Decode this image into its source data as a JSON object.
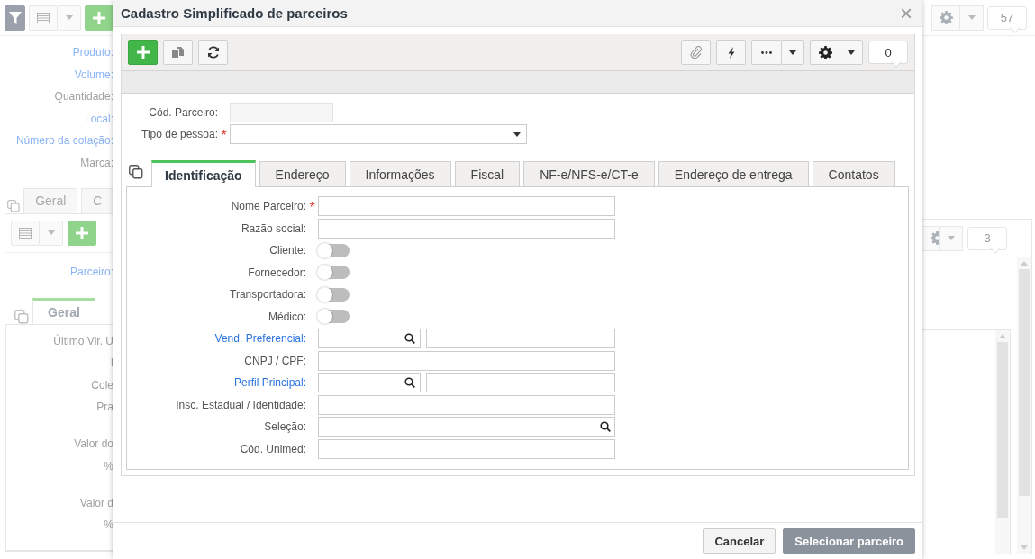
{
  "background": {
    "top_badge": "57",
    "fields": [
      {
        "label": "Produto:",
        "link": true
      },
      {
        "label": "Volume:",
        "link": true
      },
      {
        "label": "Quantidade:",
        "link": false
      },
      {
        "label": "Local:",
        "link": true
      },
      {
        "label": "Número da cotação:",
        "link": true
      },
      {
        "label": "Marca:",
        "link": false
      }
    ],
    "tabs": [
      {
        "label": "Geral",
        "selected": false
      },
      {
        "label": "C",
        "selected": false
      }
    ],
    "panel": {
      "badge": "3",
      "fields": [
        {
          "label": "Parceiro:",
          "link": true
        }
      ],
      "tabs": [
        {
          "label": "Geral",
          "selected": true
        }
      ],
      "label_groups": [
        [
          "Último Vlr. U",
          "I",
          "Cole",
          "Pra"
        ],
        [
          "Valor do",
          "%"
        ],
        [
          "Valor d",
          "%"
        ]
      ]
    }
  },
  "dialog": {
    "title": "Cadastro Simplificado de parceiros",
    "close": "×",
    "required_mark": "*",
    "badge": "0",
    "cod_parceiro": {
      "label": "Cód. Parceiro:",
      "disabled": true
    },
    "tipo_pessoa": {
      "label": "Tipo de pessoa:",
      "required": true
    },
    "tabs": [
      {
        "label": "Identificação",
        "selected": true
      },
      {
        "label": "Endereço",
        "selected": false
      },
      {
        "label": "Informações",
        "selected": false
      },
      {
        "label": "Fiscal",
        "selected": false
      },
      {
        "label": "NF-e/NFS-e/CT-e",
        "selected": false
      },
      {
        "label": "Endereço de entrega",
        "selected": false
      },
      {
        "label": "Contatos",
        "selected": false
      }
    ],
    "fields": [
      {
        "kind": "text",
        "label": "Nome Parceiro:",
        "link": false,
        "required": true
      },
      {
        "kind": "text",
        "label": "Razão social:",
        "link": false,
        "required": false
      },
      {
        "kind": "toggle",
        "label": "Cliente:",
        "link": false,
        "on": false
      },
      {
        "kind": "toggle",
        "label": "Fornecedor:",
        "link": false,
        "on": false
      },
      {
        "kind": "toggle",
        "label": "Transportadora:",
        "link": false,
        "on": false
      },
      {
        "kind": "toggle",
        "label": "Médico:",
        "link": false,
        "on": false
      },
      {
        "kind": "lookup",
        "label": "Vend. Preferencial:",
        "link": true
      },
      {
        "kind": "text",
        "label": "CNPJ / CPF:",
        "link": false,
        "required": false
      },
      {
        "kind": "lookup",
        "label": "Perfil Principal:",
        "link": true
      },
      {
        "kind": "text",
        "label": "Insc. Estadual / Identidade:",
        "link": false,
        "required": false
      },
      {
        "kind": "search",
        "label": "Seleção:",
        "link": false
      },
      {
        "kind": "text",
        "label": "Cód. Unimed:",
        "link": false,
        "required": false
      }
    ],
    "buttons": [
      {
        "label": "Cancelar",
        "primary": false
      },
      {
        "label": "Selecionar parceiro",
        "primary": true
      }
    ]
  }
}
